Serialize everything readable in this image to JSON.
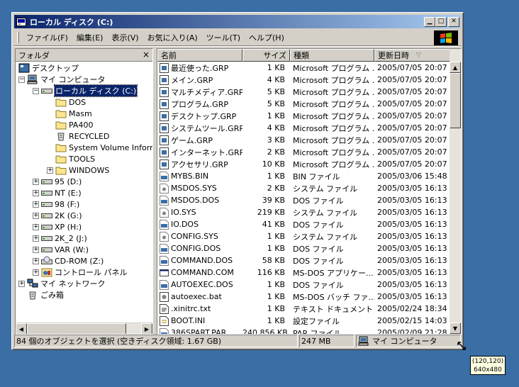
{
  "window": {
    "title": "ローカル ディスク (C:)"
  },
  "menu": [
    "ファイル(F)",
    "編集(E)",
    "表示(V)",
    "お気に入り(A)",
    "ツール(T)",
    "ヘルプ(H)"
  ],
  "tree": {
    "header": "フォルダ",
    "close_glyph": "×",
    "nodes": [
      {
        "label": "デスクトップ",
        "icon": "desktop-icon",
        "level": 0,
        "expander": ""
      },
      {
        "label": "マイ コンピュータ",
        "icon": "my-computer-icon",
        "level": 1,
        "expander": "−"
      },
      {
        "label": "ローカル ディスク (C:)",
        "icon": "drive-icon",
        "level": 2,
        "expander": "−",
        "selected": true
      },
      {
        "label": "DOS",
        "icon": "folder-icon",
        "level": 3,
        "expander": ""
      },
      {
        "label": "Masm",
        "icon": "folder-icon",
        "level": 3,
        "expander": ""
      },
      {
        "label": "PA400",
        "icon": "folder-icon",
        "level": 3,
        "expander": ""
      },
      {
        "label": "RECYCLED",
        "icon": "recycle-bin-icon",
        "level": 3,
        "expander": ""
      },
      {
        "label": "System Volume Information",
        "icon": "folder-icon",
        "level": 3,
        "expander": ""
      },
      {
        "label": "TOOLS",
        "icon": "folder-icon",
        "level": 3,
        "expander": ""
      },
      {
        "label": "WINDOWS",
        "icon": "folder-icon",
        "level": 3,
        "expander": "+"
      },
      {
        "label": "95 (D:)",
        "icon": "drive-icon",
        "level": 2,
        "expander": "+"
      },
      {
        "label": "NT (E:)",
        "icon": "drive-icon",
        "level": 2,
        "expander": "+"
      },
      {
        "label": "98 (F:)",
        "icon": "drive-icon",
        "level": 2,
        "expander": "+"
      },
      {
        "label": "2K (G:)",
        "icon": "drive-icon",
        "level": 2,
        "expander": "+"
      },
      {
        "label": "XP (H:)",
        "icon": "drive-icon",
        "level": 2,
        "expander": "+"
      },
      {
        "label": "2K_2 (J:)",
        "icon": "drive-icon",
        "level": 2,
        "expander": "+"
      },
      {
        "label": "VAR (W:)",
        "icon": "drive-icon",
        "level": 2,
        "expander": "+"
      },
      {
        "label": "CD-ROM (Z:)",
        "icon": "cdrom-icon",
        "level": 2,
        "expander": "+"
      },
      {
        "label": "コントロール パネル",
        "icon": "control-panel-icon",
        "level": 2,
        "expander": "+"
      },
      {
        "label": "マイ ネットワーク",
        "icon": "network-icon",
        "level": 1,
        "expander": "+"
      },
      {
        "label": "ごみ箱",
        "icon": "recycle-bin-icon",
        "level": 1,
        "expander": ""
      }
    ]
  },
  "list": {
    "columns": [
      "名前",
      "サイズ",
      "種類",
      "更新日時"
    ],
    "sort_glyph": "▽",
    "rows": [
      {
        "name": "最近使った.GRP",
        "size": "1 KB",
        "type": "Microsoft プログラム ...",
        "date": "2005/07/05 20:07",
        "icon": "grp-file-icon"
      },
      {
        "name": "メイン.GRP",
        "size": "4 KB",
        "type": "Microsoft プログラム ...",
        "date": "2005/07/05 20:07",
        "icon": "grp-file-icon"
      },
      {
        "name": "マルチメディア.GRP",
        "size": "5 KB",
        "type": "Microsoft プログラム ...",
        "date": "2005/07/05 20:07",
        "icon": "grp-file-icon"
      },
      {
        "name": "プログラム.GRP",
        "size": "5 KB",
        "type": "Microsoft プログラム ...",
        "date": "2005/07/05 20:07",
        "icon": "grp-file-icon"
      },
      {
        "name": "デスクトップ.GRP",
        "size": "1 KB",
        "type": "Microsoft プログラム ...",
        "date": "2005/07/05 20:07",
        "icon": "grp-file-icon"
      },
      {
        "name": "システムツール.GRP",
        "size": "4 KB",
        "type": "Microsoft プログラム ...",
        "date": "2005/07/05 20:07",
        "icon": "grp-file-icon"
      },
      {
        "name": "ゲーム.GRP",
        "size": "3 KB",
        "type": "Microsoft プログラム ...",
        "date": "2005/07/05 20:07",
        "icon": "grp-file-icon"
      },
      {
        "name": "インターネット.GRP",
        "size": "2 KB",
        "type": "Microsoft プログラム ...",
        "date": "2005/07/05 20:07",
        "icon": "grp-file-icon"
      },
      {
        "name": "アクセサリ.GRP",
        "size": "10 KB",
        "type": "Microsoft プログラム ...",
        "date": "2005/07/05 20:07",
        "icon": "grp-file-icon"
      },
      {
        "name": "MYBS.BIN",
        "size": "1 KB",
        "type": "BIN ファイル",
        "date": "2005/03/06 15:48",
        "icon": "bin-file-icon"
      },
      {
        "name": "MSDOS.SYS",
        "size": "2 KB",
        "type": "システム ファイル",
        "date": "2005/03/05 16:13",
        "icon": "system-file-icon"
      },
      {
        "name": "MSDOS.DOS",
        "size": "39 KB",
        "type": "DOS ファイル",
        "date": "2005/03/05 16:13",
        "icon": "generic-file-icon"
      },
      {
        "name": "IO.SYS",
        "size": "219 KB",
        "type": "システム ファイル",
        "date": "2005/03/05 16:13",
        "icon": "system-file-icon"
      },
      {
        "name": "IO.DOS",
        "size": "41 KB",
        "type": "DOS ファイル",
        "date": "2005/03/05 16:13",
        "icon": "generic-file-icon"
      },
      {
        "name": "CONFIG.SYS",
        "size": "1 KB",
        "type": "システム ファイル",
        "date": "2005/03/05 16:13",
        "icon": "system-file-icon"
      },
      {
        "name": "CONFIG.DOS",
        "size": "1 KB",
        "type": "DOS ファイル",
        "date": "2005/03/05 16:13",
        "icon": "generic-file-icon"
      },
      {
        "name": "COMMAND.DOS",
        "size": "58 KB",
        "type": "DOS ファイル",
        "date": "2005/03/05 16:13",
        "icon": "generic-file-icon"
      },
      {
        "name": "COMMAND.COM",
        "size": "116 KB",
        "type": "MS-DOS アプリケー...",
        "date": "2005/03/05 16:13",
        "icon": "dos-app-icon"
      },
      {
        "name": "AUTOEXEC.DOS",
        "size": "1 KB",
        "type": "DOS ファイル",
        "date": "2005/03/05 16:13",
        "icon": "generic-file-icon"
      },
      {
        "name": "autoexec.bat",
        "size": "1 KB",
        "type": "MS-DOS バッチ ファ...",
        "date": "2005/03/05 16:13",
        "icon": "batch-file-icon"
      },
      {
        "name": ".xinitrc.txt",
        "size": "1 KB",
        "type": "テキスト ドキュメント",
        "date": "2005/02/24 18:34",
        "icon": "text-file-icon"
      },
      {
        "name": "BOOT.INI",
        "size": "1 KB",
        "type": "設定ファイル",
        "date": "2005/02/15 14:03",
        "icon": "ini-file-icon"
      },
      {
        "name": "386SPART.PAR",
        "size": "240,856 KB",
        "type": "PAR ファイル",
        "date": "2005/02/09 21:28",
        "icon": "generic-file-icon"
      }
    ]
  },
  "status": {
    "selection": "84 個のオブジェクトを選択 (空きディスク領域: 1.67 GB)",
    "size": "247 MB",
    "location": "マイ コンピュータ"
  },
  "tooltip": {
    "line1": "(120,120)",
    "line2": "640x480"
  },
  "colors": {
    "desktop": "#3a6ea5",
    "title_start": "#0a246a",
    "title_end": "#a6caf0",
    "face": "#d4d0c8",
    "selection": "#0a246a"
  }
}
